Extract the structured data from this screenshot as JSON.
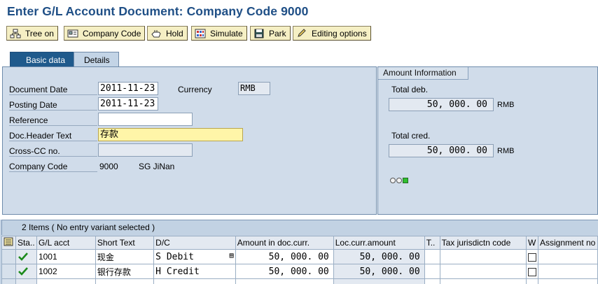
{
  "window": {
    "title": "Enter G/L Account Document: Company Code 9000"
  },
  "toolbar": {
    "tree_on": "Tree on",
    "company_code": "Company Code",
    "hold": "Hold",
    "simulate": "Simulate",
    "park": "Park",
    "editing_options": "Editing options"
  },
  "tabs": {
    "basic": "Basic data",
    "details": "Details"
  },
  "basic": {
    "doc_date_label": "Document Date",
    "doc_date": "2011-11-23",
    "currency_label": "Currency",
    "currency": "RMB",
    "posting_date_label": "Posting Date",
    "posting_date": "2011-11-23",
    "reference_label": "Reference",
    "reference": "",
    "header_text_label": "Doc.Header Text",
    "header_text": "存款",
    "cross_cc_label": "Cross-CC no.",
    "cross_cc": "",
    "company_code_label": "Company Code",
    "company_code": "9000",
    "company_name": "SG JiNan"
  },
  "amount": {
    "title": "Amount Information",
    "total_deb_label": "Total deb.",
    "total_deb": "50, 000. 00",
    "total_deb_cur": "RMB",
    "total_cred_label": "Total cred.",
    "total_cred": "50, 000. 00",
    "total_cred_cur": "RMB"
  },
  "grid": {
    "title": "2 Items ( No entry variant selected )",
    "columns": [
      "Sta..",
      "G/L acct",
      "Short Text",
      "D/C",
      "Amount in doc.curr.",
      "Loc.curr.amount",
      "T..",
      "Tax jurisdictn code",
      "W",
      "Assignment no"
    ],
    "rows": [
      {
        "gl": "1001",
        "text": "现金",
        "dc": "S Debit",
        "amount": "50, 000. 00",
        "loc": "50, 000. 00"
      },
      {
        "gl": "1002",
        "text": "银行存款",
        "dc": "H Credit",
        "amount": "50, 000. 00",
        "loc": "50, 000. 00"
      }
    ]
  }
}
